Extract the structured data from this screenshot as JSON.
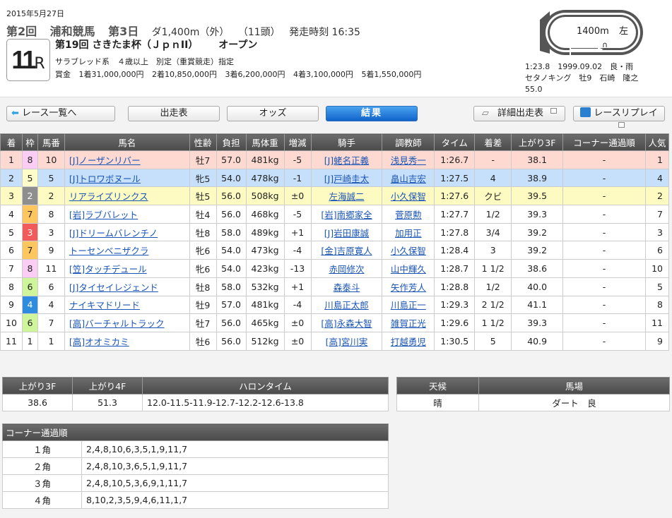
{
  "header": {
    "date": "2015年5月27日",
    "meeting": "第2回",
    "venue": "浦和競馬",
    "day": "第3日",
    "course": "ダ1,400m（外）",
    "runners": "（11頭）",
    "post_time": "発走時刻 16:35",
    "race_number": "11",
    "race_suffix": "R",
    "race_title": "第19回 さきたま杯（ＪｐｎII）",
    "race_grade": "オープン",
    "conditions": "サラブレッド系　４歳以上　別定（重賞競走）指定",
    "prize_label": "賞金",
    "prizes": [
      "1着31,000,000円",
      "2着10,850,000円",
      "3着6,200,000円",
      "4着3,100,000円",
      "5着1,550,000円"
    ]
  },
  "course_map": {
    "distance": "1400m",
    "direction": "左",
    "record_line1": "1:23.8　1999.09.02　良・雨",
    "record_line2": "セタノキング　牡9　石崎　隆之",
    "record_line3": "55.0"
  },
  "nav": {
    "back": "レース一覧へ",
    "entries": "出走表",
    "odds": "オッズ",
    "results": "結果",
    "detailed_entries": "詳細出走表",
    "replay": "レースリプレイ"
  },
  "results_table": {
    "headers": [
      "着",
      "枠",
      "馬番",
      "馬名",
      "性齢",
      "負担",
      "馬体重",
      "増減",
      "騎手",
      "調教師",
      "タイム",
      "着差",
      "上がり3F",
      "コーナー通過順",
      "人気"
    ],
    "rows": [
      {
        "pos": "1",
        "waku": "8",
        "num": "10",
        "horse": "[J]ノーザンリバー",
        "sex_age": "牡7",
        "weight": "57.0",
        "body": "481kg",
        "diff": "-5",
        "jockey": "[J]蛯名正義",
        "trainer": "浅見秀一",
        "time": "1:26.7",
        "margin": "-",
        "last3f": "38.1",
        "corner": "-",
        "pop": "1"
      },
      {
        "pos": "2",
        "waku": "5",
        "num": "5",
        "horse": "[J]トロワボヌール",
        "sex_age": "牝5",
        "weight": "54.0",
        "body": "478kg",
        "diff": "-1",
        "jockey": "[J]戸崎圭太",
        "trainer": "畠山吉宏",
        "time": "1:27.5",
        "margin": "4",
        "last3f": "38.9",
        "corner": "-",
        "pop": "4"
      },
      {
        "pos": "3",
        "waku": "2",
        "num": "2",
        "horse": "リアライズリンクス",
        "sex_age": "牡5",
        "weight": "56.0",
        "body": "508kg",
        "diff": "±0",
        "jockey": "左海誠二",
        "trainer": "小久保智",
        "time": "1:27.6",
        "margin": "クビ",
        "last3f": "39.5",
        "corner": "-",
        "pop": "2"
      },
      {
        "pos": "4",
        "waku": "7",
        "num": "8",
        "horse": "[岩]ラブバレット",
        "sex_age": "牡4",
        "weight": "56.0",
        "body": "468kg",
        "diff": "-5",
        "jockey": "[岩]南郷家全",
        "trainer": "菅原勲",
        "time": "1:27.7",
        "margin": "1/2",
        "last3f": "39.3",
        "corner": "-",
        "pop": "7"
      },
      {
        "pos": "5",
        "waku": "3",
        "num": "3",
        "horse": "[J]ドリームバレンチノ",
        "sex_age": "牡8",
        "weight": "58.0",
        "body": "489kg",
        "diff": "+1",
        "jockey": "[J]岩田康誠",
        "trainer": "加用正",
        "time": "1:27.8",
        "margin": "3/4",
        "last3f": "39.2",
        "corner": "-",
        "pop": "3"
      },
      {
        "pos": "6",
        "waku": "7",
        "num": "9",
        "horse": "トーセンベニザクラ",
        "sex_age": "牝6",
        "weight": "54.0",
        "body": "473kg",
        "diff": "-4",
        "jockey": "[金]吉原寛人",
        "trainer": "小久保智",
        "time": "1:28.4",
        "margin": "3",
        "last3f": "39.2",
        "corner": "-",
        "pop": "6"
      },
      {
        "pos": "7",
        "waku": "8",
        "num": "11",
        "horse": "[笠]タッチデュール",
        "sex_age": "牝6",
        "weight": "54.0",
        "body": "423kg",
        "diff": "-13",
        "jockey": "赤岡修次",
        "trainer": "山中輝久",
        "time": "1:28.7",
        "margin": "1 1/2",
        "last3f": "38.6",
        "corner": "-",
        "pop": "10"
      },
      {
        "pos": "8",
        "waku": "6",
        "num": "6",
        "horse": "[J]タイセイレジェンド",
        "sex_age": "牡8",
        "weight": "58.0",
        "body": "532kg",
        "diff": "+1",
        "jockey": "森泰斗",
        "trainer": "矢作芳人",
        "time": "1:28.8",
        "margin": "1/2",
        "last3f": "40.0",
        "corner": "-",
        "pop": "5"
      },
      {
        "pos": "9",
        "waku": "4",
        "num": "4",
        "horse": "ナイキマドリード",
        "sex_age": "牡9",
        "weight": "57.0",
        "body": "481kg",
        "diff": "-4",
        "jockey": "川島正太郎",
        "trainer": "川島正一",
        "time": "1:29.3",
        "margin": "2 1/2",
        "last3f": "41.1",
        "corner": "-",
        "pop": "8"
      },
      {
        "pos": "10",
        "waku": "6",
        "num": "7",
        "horse": "[高]バーチャルトラック",
        "sex_age": "牡7",
        "weight": "56.0",
        "body": "465kg",
        "diff": "±0",
        "jockey": "[高]永森大智",
        "trainer": "雑賀正光",
        "time": "1:29.6",
        "margin": "1 1/2",
        "last3f": "39.3",
        "corner": "-",
        "pop": "11"
      },
      {
        "pos": "11",
        "waku": "1",
        "num": "1",
        "horse": "[高]オオミカミ",
        "sex_age": "牡6",
        "weight": "56.0",
        "body": "512kg",
        "diff": "±0",
        "jockey": "[高]宮川実",
        "trainer": "打越勇児",
        "time": "1:30.5",
        "margin": "5",
        "last3f": "40.9",
        "corner": "-",
        "pop": "9"
      }
    ]
  },
  "laps": {
    "headers": [
      "上がり3F",
      "上がり4F",
      "ハロンタイム"
    ],
    "last3f": "38.6",
    "last4f": "51.3",
    "furlongs": "12.0-11.5-11.9-12.7-12.2-12.6-13.8"
  },
  "conditions_table": {
    "headers": [
      "天候",
      "馬場"
    ],
    "weather": "晴",
    "track": "ダート　良"
  },
  "corners": {
    "title": "コーナー通過順",
    "rows": [
      {
        "label": "１角",
        "order": "2,4,8,10,6,3,5,1,9,11,7"
      },
      {
        "label": "２角",
        "order": "2,4,8,10,3,6,5,1,9,11,7"
      },
      {
        "label": "３角",
        "order": "2,4,8,10,5,3,6,9,1,11,7"
      },
      {
        "label": "４角",
        "order": "8,10,2,3,5,9,4,6,11,1,7"
      }
    ]
  }
}
